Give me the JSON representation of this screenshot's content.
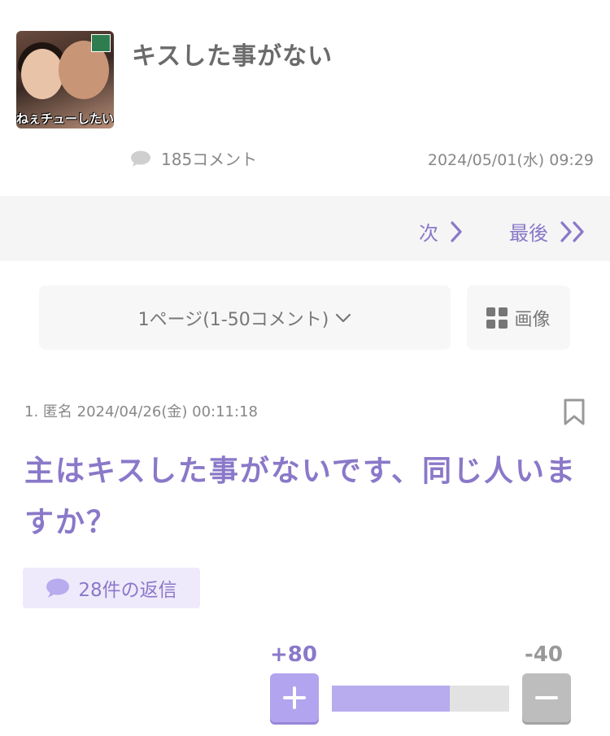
{
  "thread": {
    "title": "キスした事がない",
    "thumbnail_caption": "ねぇチューしたい",
    "comment_count_label": "185コメント",
    "posted_date": "2024/05/01(水) 09:29"
  },
  "nav": {
    "next_label": "次",
    "last_label": "最後"
  },
  "pager": {
    "current_page_label": "1ページ(1-50コメント)",
    "image_label": "画像"
  },
  "comment": {
    "meta": "1. 匿名 2024/04/26(金) 00:11:18",
    "body": "主はキスした事がないです、同じ人いますか？",
    "reply_label": "28件の返信"
  },
  "votes": {
    "plus": "+80",
    "minus": "-40",
    "plus_ratio": 0.667
  },
  "colors": {
    "accent": "#8a78c9",
    "plus_button": "#b2a4ee",
    "minus_button": "#bdbdbd"
  },
  "icons": [
    "speech-bubble-icon",
    "chevron-right-icon",
    "double-chevron-right-icon",
    "chevron-down-icon",
    "grid-icon",
    "bookmark-icon",
    "plus-icon",
    "minus-icon"
  ]
}
